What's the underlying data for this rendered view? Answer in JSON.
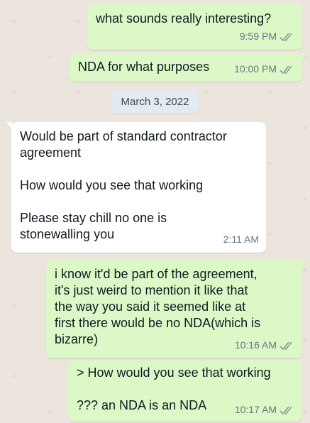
{
  "date_separator": "March 3, 2022",
  "messages": [
    {
      "direction": "outgoing",
      "text": "what sounds really interesting?",
      "time": "9:59 PM",
      "status": "read"
    },
    {
      "direction": "outgoing",
      "text": "NDA for what purposes",
      "time": "10:00 PM",
      "status": "read"
    },
    {
      "direction": "incoming",
      "text": "Would be part of standard contractor\nagreement\n\nHow would you see that working\n\nPlease stay chill no one is\nstonewalling you",
      "time": "2:11 AM"
    },
    {
      "direction": "outgoing",
      "text": "i know it'd be part of the agreement,\nit's just weird to mention it like that\nthe way you said it seemed like at\nfirst there would be no NDA(which is\nbizarre)",
      "time": "10:16 AM",
      "status": "read"
    },
    {
      "direction": "outgoing",
      "text": "> How would you see that working\n\n??? an NDA is an NDA",
      "time": "10:17 AM",
      "status": "read"
    }
  ],
  "colors": {
    "outgoing_bubble": "#dcf8c6",
    "incoming_bubble": "#ffffff",
    "background": "#ece5dd",
    "timestamp": "#667781",
    "read_ticks": "#8696a0"
  },
  "icons": {
    "read_receipt": "double-check-icon"
  }
}
